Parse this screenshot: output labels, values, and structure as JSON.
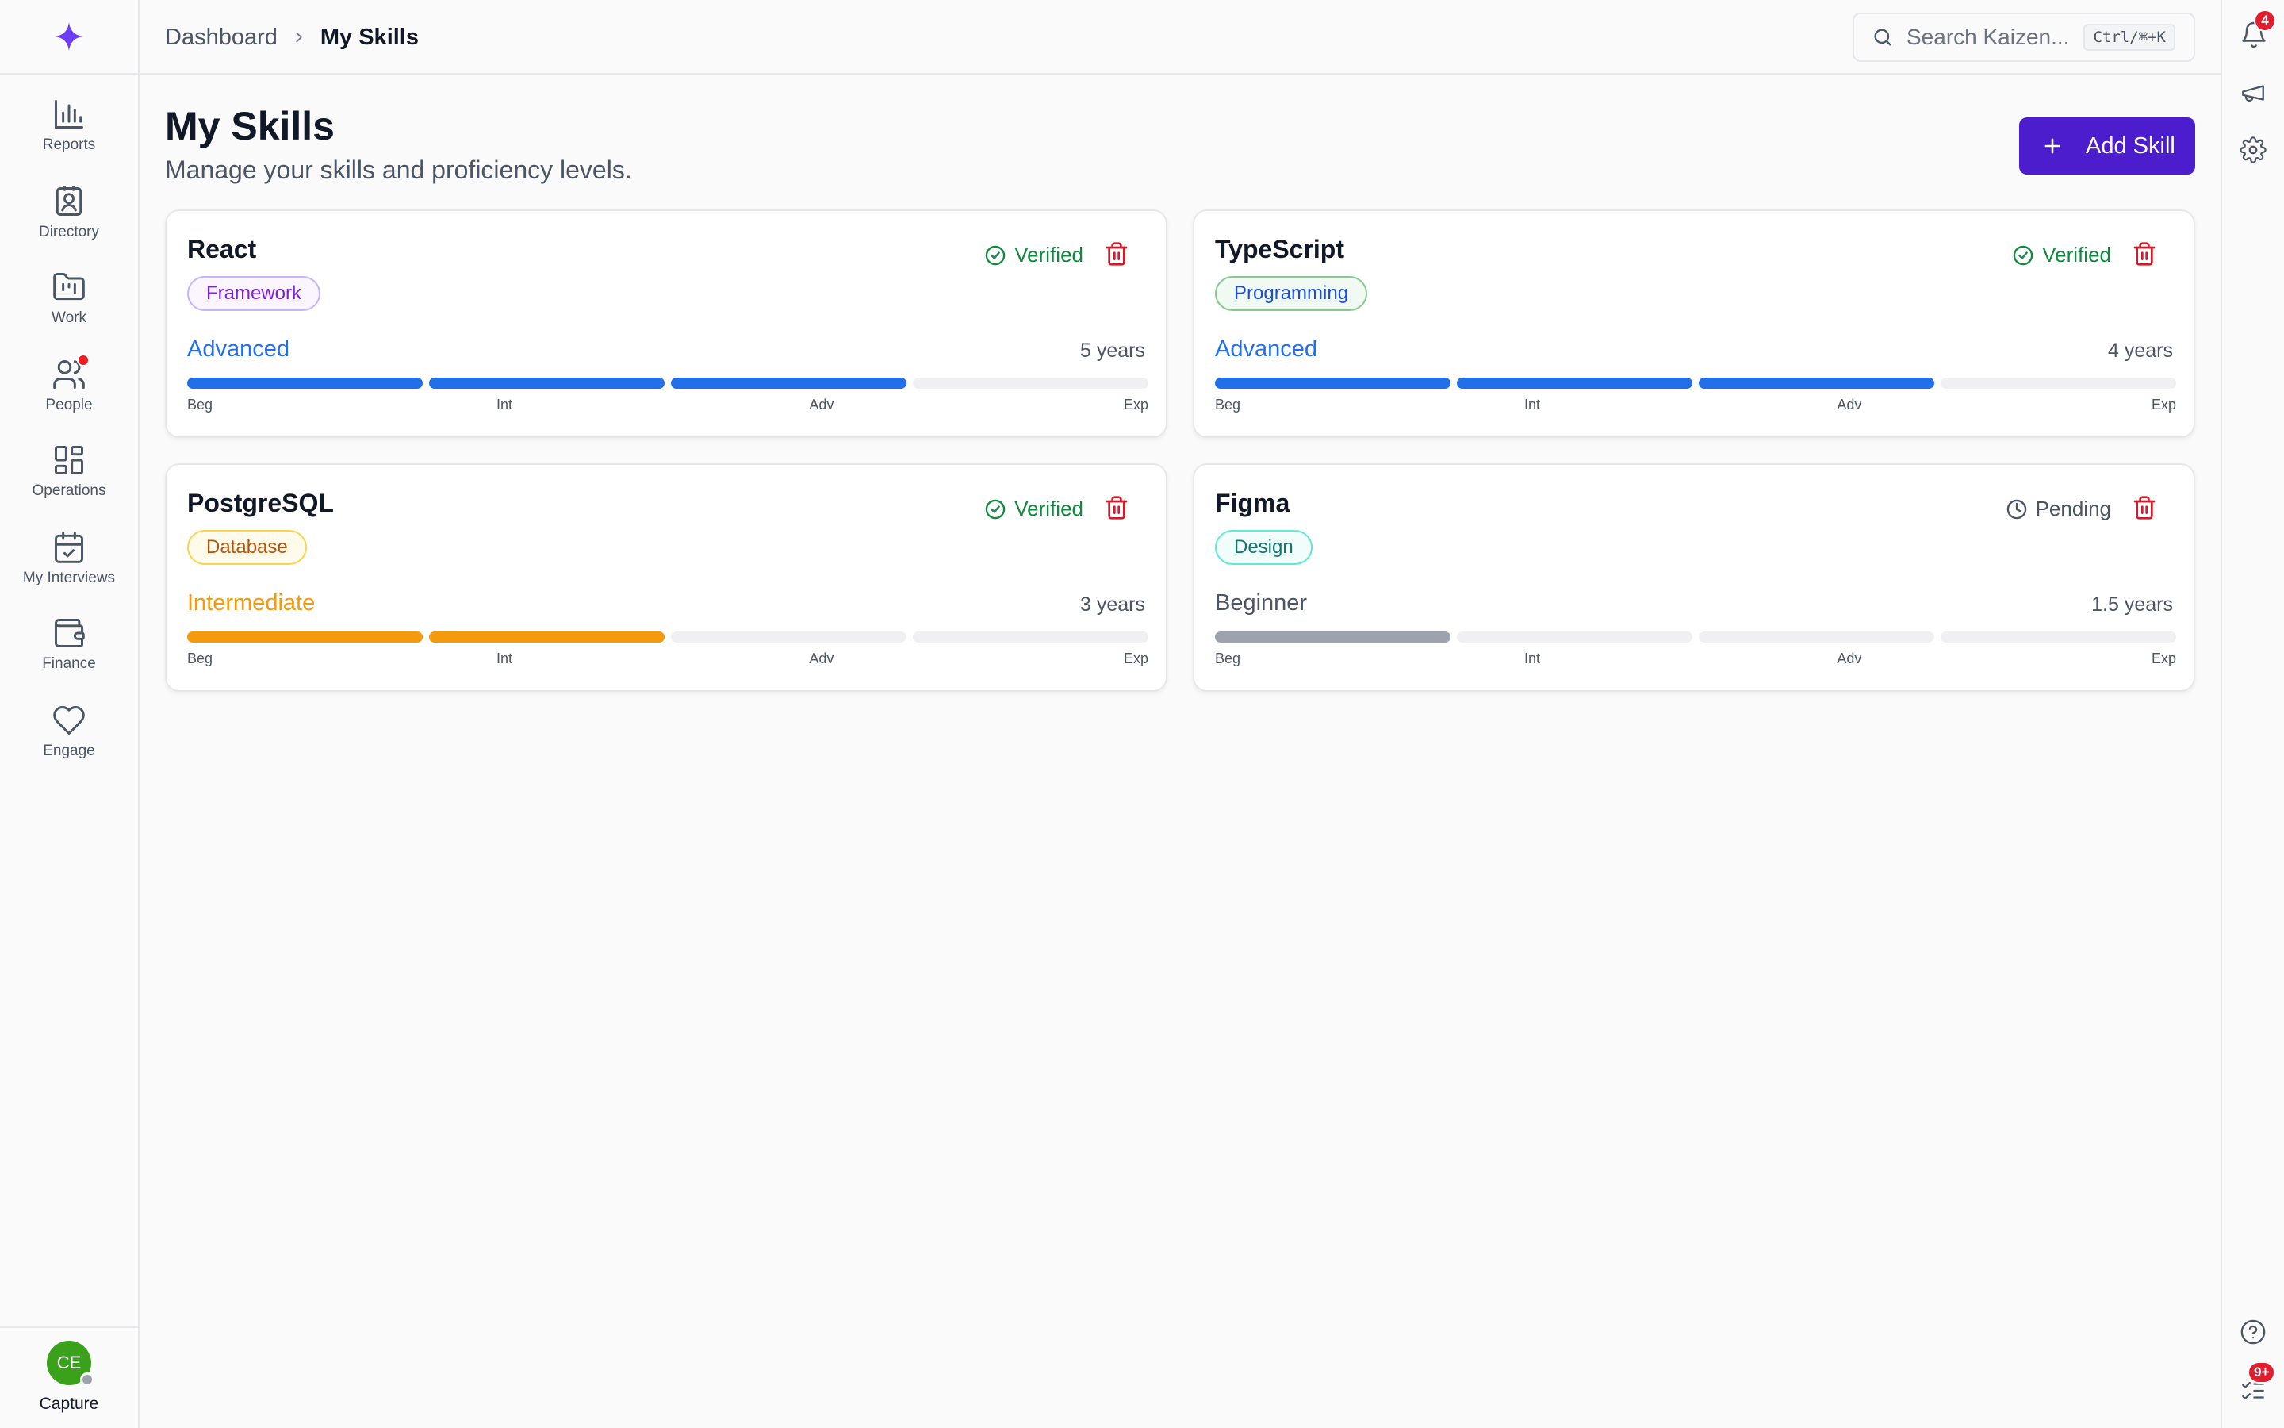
{
  "breadcrumb": {
    "parent": "Dashboard",
    "current": "My Skills"
  },
  "search": {
    "placeholder": "Search Kaizen...",
    "shortcut": "Ctrl/⌘+K"
  },
  "sidebar": {
    "items": [
      {
        "label": "Reports",
        "icon": "bar-chart-icon"
      },
      {
        "label": "Directory",
        "icon": "contact-card-icon"
      },
      {
        "label": "Work",
        "icon": "folder-kanban-icon"
      },
      {
        "label": "People",
        "icon": "users-icon",
        "has_dot": true
      },
      {
        "label": "Operations",
        "icon": "grid-icon"
      },
      {
        "label": "My Interviews",
        "icon": "calendar-check-icon"
      },
      {
        "label": "Finance",
        "icon": "wallet-icon"
      },
      {
        "label": "Engage",
        "icon": "heart-icon"
      }
    ],
    "user": {
      "initials": "CE",
      "label": "Capture"
    }
  },
  "rail": {
    "notifications_count": "4",
    "tasks_count": "9+"
  },
  "page": {
    "title": "My Skills",
    "subtitle": "Manage your skills and proficiency levels.",
    "add_label": "Add Skill"
  },
  "level_labels": [
    "Beg",
    "Int",
    "Adv",
    "Exp"
  ],
  "colors": {
    "accent": "#4c1dcc",
    "advanced": "#2270e8",
    "intermediate": "#f59a0c",
    "beginner": "#9ca3af",
    "verified": "#108a3e",
    "delete": "#d11a2a"
  },
  "skills": [
    {
      "name": "React",
      "category": "Framework",
      "status": "Verified",
      "level": "Advanced",
      "level_index": 3,
      "years": "5 years"
    },
    {
      "name": "TypeScript",
      "category": "Programming",
      "status": "Verified",
      "level": "Advanced",
      "level_index": 3,
      "years": "4 years"
    },
    {
      "name": "PostgreSQL",
      "category": "Database",
      "status": "Verified",
      "level": "Intermediate",
      "level_index": 2,
      "years": "3 years"
    },
    {
      "name": "Figma",
      "category": "Design",
      "status": "Pending",
      "level": "Beginner",
      "level_index": 1,
      "years": "1.5 years"
    }
  ]
}
